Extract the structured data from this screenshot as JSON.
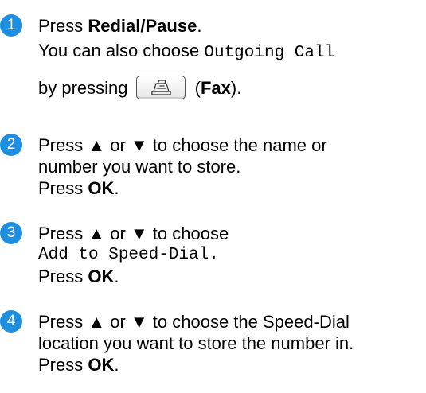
{
  "steps": [
    {
      "number": "1",
      "line1_prefix": "Press ",
      "line1_bold": "Redial/Pause",
      "line1_suffix": ".",
      "line2_text": "You can also choose ",
      "line2_mono": "Outgoing Call",
      "line3_prefix": "by pressing",
      "line3_paren_open": " (",
      "line3_bold": "Fax",
      "line3_paren_close": ")."
    },
    {
      "number": "2",
      "line1": "Press ▲ or ▼ to choose the name or",
      "line2": "number you want to store.",
      "press_prefix": "Press ",
      "press_bold": "OK",
      "press_suffix": "."
    },
    {
      "number": "3",
      "line1": "Press ▲ or ▼ to choose",
      "line2_mono": "Add to Speed-Dial.",
      "press_prefix": "Press ",
      "press_bold": "OK",
      "press_suffix": "."
    },
    {
      "number": "4",
      "line1": "Press ▲ or ▼ to choose the Speed-Dial",
      "line2": "location you want to store the number in.",
      "press_prefix": "Press ",
      "press_bold": "OK",
      "press_suffix": "."
    }
  ],
  "icons": {
    "fax_key": "fax-key-icon"
  },
  "colors": {
    "badge": "#1e8fe0"
  }
}
